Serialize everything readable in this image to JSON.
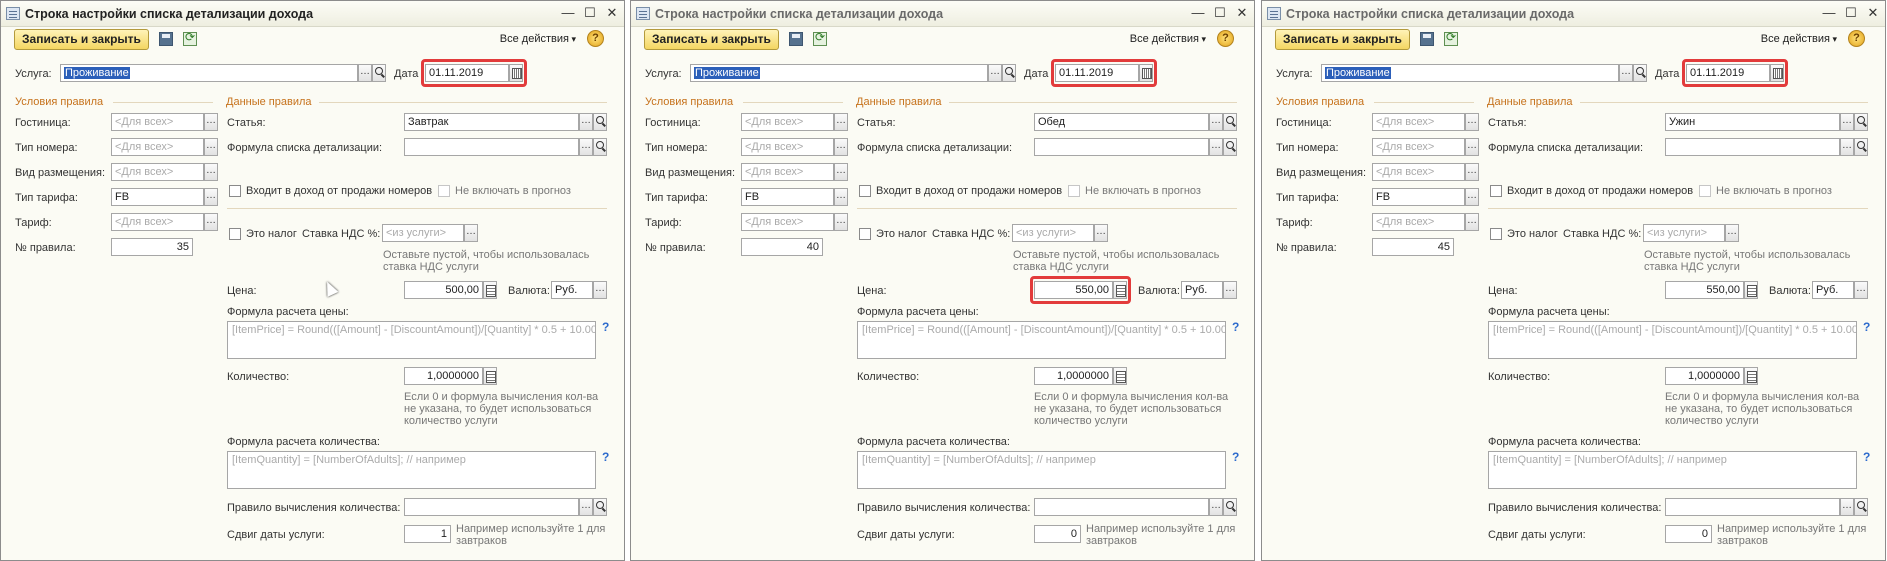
{
  "windows": [
    {
      "title": "Строка настройки списка детализации дохода",
      "active": true,
      "save_label": "Записать и закрыть",
      "all_actions": "Все действия",
      "help": "?",
      "service_label": "Услуга:",
      "service_value": "Проживание",
      "date_label": "Дата",
      "date_value": "01.11.2019",
      "conditions_header": "Условия правила",
      "data_header": "Данные правила",
      "hotel_label": "Гостиница:",
      "hotel_value": "<Для всех>",
      "room_type_label": "Тип номера:",
      "room_type_value": "<Для всех>",
      "accommodation_label": "Вид размещения:",
      "accommodation_value": "<Для всех>",
      "rate_type_label": "Тип тарифа:",
      "rate_type_value": "FB",
      "rate_label": "Тариф:",
      "rate_value": "<Для всех>",
      "rule_no_label": "№ правила:",
      "rule_no_value": "35",
      "article_label": "Статья:",
      "article_value": "Завтрак",
      "formula_list_label": "Формула списка детализации:",
      "income_checkbox_label": "Входит в доход от продажи номеров",
      "forecast_checkbox_label": "Не включать в прогноз",
      "tax_checkbox_label": "Это налог",
      "vat_label": "Ставка НДС %:",
      "vat_value": "<из услуги>",
      "vat_hint_1": "Оставьте пустой, чтобы использовалась",
      "vat_hint_2": "ставка НДС услуги",
      "price_label": "Цена:",
      "price_value": "500,00",
      "currency_label": "Валюта:",
      "currency_value": "Руб.",
      "price_formula_label": "Формула расчета цены:",
      "price_formula_placeholder": "[ItemPrice] = Round(([Amount] - [DiscountAmount])/[Quantity] * 0.5 + 10.00...",
      "qty_label": "Количество:",
      "qty_value": "1,0000000",
      "qty_hint_1": "Если 0 и формула вычисления кол-ва",
      "qty_hint_2": "не указана, то будет использоваться",
      "qty_hint_3": "количество услуги",
      "qty_formula_label": "Формула расчета количества:",
      "qty_formula_placeholder": "[ItemQuantity] = [NumberOfAdults]; // например",
      "qty_rule_label": "Правило вычисления количества:",
      "date_shift_label": "Сдвиг даты услуги:",
      "date_shift_value": "1",
      "date_shift_hint_1": "Например используйте 1 для",
      "date_shift_hint_2": "завтраков"
    },
    {
      "title": "Строка настройки списка детализации дохода",
      "active": false,
      "save_label": "Записать и закрыть",
      "all_actions": "Все действия",
      "help": "?",
      "service_label": "Услуга:",
      "service_value": "Проживание",
      "date_label": "Дата",
      "date_value": "01.11.2019",
      "conditions_header": "Условия правила",
      "data_header": "Данные правила",
      "hotel_label": "Гостиница:",
      "hotel_value": "<Для всех>",
      "room_type_label": "Тип номера:",
      "room_type_value": "<Для всех>",
      "accommodation_label": "Вид размещения:",
      "accommodation_value": "<Для всех>",
      "rate_type_label": "Тип тарифа:",
      "rate_type_value": "FB",
      "rate_label": "Тариф:",
      "rate_value": "<Для всех>",
      "rule_no_label": "№ правила:",
      "rule_no_value": "40",
      "article_label": "Статья:",
      "article_value": "Обед",
      "formula_list_label": "Формула списка детализации:",
      "income_checkbox_label": "Входит в доход от продажи номеров",
      "forecast_checkbox_label": "Не включать в прогноз",
      "tax_checkbox_label": "Это налог",
      "vat_label": "Ставка НДС %:",
      "vat_value": "<из услуги>",
      "vat_hint_1": "Оставьте пустой, чтобы использовалась",
      "vat_hint_2": "ставка НДС услуги",
      "price_label": "Цена:",
      "price_value": "550,00",
      "currency_label": "Валюта:",
      "currency_value": "Руб.",
      "price_formula_label": "Формула расчета цены:",
      "price_formula_placeholder": "[ItemPrice] = Round(([Amount] - [DiscountAmount])/[Quantity] * 0.5 + 10.00...",
      "qty_label": "Количество:",
      "qty_value": "1,0000000",
      "qty_hint_1": "Если 0 и формула вычисления кол-ва",
      "qty_hint_2": "не указана, то будет использоваться",
      "qty_hint_3": "количество услуги",
      "qty_formula_label": "Формула расчета количества:",
      "qty_formula_placeholder": "[ItemQuantity] = [NumberOfAdults]; // например",
      "qty_rule_label": "Правило вычисления количества:",
      "date_shift_label": "Сдвиг даты услуги:",
      "date_shift_value": "0",
      "date_shift_hint_1": "Например используйте 1 для",
      "date_shift_hint_2": "завтраков"
    },
    {
      "title": "Строка настройки списка детализации дохода",
      "active": false,
      "save_label": "Записать и закрыть",
      "all_actions": "Все действия",
      "help": "?",
      "service_label": "Услуга:",
      "service_value": "Проживание",
      "date_label": "Дата",
      "date_value": "01.11.2019",
      "conditions_header": "Условия правила",
      "data_header": "Данные правила",
      "hotel_label": "Гостиница:",
      "hotel_value": "<Для всех>",
      "room_type_label": "Тип номера:",
      "room_type_value": "<Для всех>",
      "accommodation_label": "Вид размещения:",
      "accommodation_value": "<Для всех>",
      "rate_type_label": "Тип тарифа:",
      "rate_type_value": "FB",
      "rate_label": "Тариф:",
      "rate_value": "<Для всех>",
      "rule_no_label": "№ правила:",
      "rule_no_value": "45",
      "article_label": "Статья:",
      "article_value": "Ужин",
      "formula_list_label": "Формула списка детализации:",
      "income_checkbox_label": "Входит в доход от продажи номеров",
      "forecast_checkbox_label": "Не включать в прогноз",
      "tax_checkbox_label": "Это налог",
      "vat_label": "Ставка НДС %:",
      "vat_value": "<из услуги>",
      "vat_hint_1": "Оставьте пустой, чтобы использовалась",
      "vat_hint_2": "ставка НДС услуги",
      "price_label": "Цена:",
      "price_value": "550,00",
      "currency_label": "Валюта:",
      "currency_value": "Руб.",
      "price_formula_label": "Формула расчета цены:",
      "price_formula_placeholder": "[ItemPrice] = Round(([Amount] - [DiscountAmount])/[Quantity] * 0.5 + 10.00...",
      "qty_label": "Количество:",
      "qty_value": "1,0000000",
      "qty_hint_1": "Если 0 и формула вычисления кол-ва",
      "qty_hint_2": "не указана, то будет использоваться",
      "qty_hint_3": "количество услуги",
      "qty_formula_label": "Формула расчета количества:",
      "qty_formula_placeholder": "[ItemQuantity] = [NumberOfAdults]; // например",
      "qty_rule_label": "Правило вычисления количества:",
      "date_shift_label": "Сдвиг даты услуги:",
      "date_shift_value": "0",
      "date_shift_hint_1": "Например используйте 1 для",
      "date_shift_hint_2": "завтраков"
    }
  ],
  "colors": {
    "section_header": "#c6721c",
    "highlight_frame": "#e23b3b",
    "save_button": "#f4d662",
    "selection": "#2c5fb9"
  },
  "icons": [
    "window-icon",
    "minimize-icon",
    "maximize-icon",
    "close-icon",
    "save-icon",
    "refresh-icon",
    "help-icon",
    "select-button-icon",
    "search-icon",
    "calendar-icon",
    "calculator-icon",
    "question-icon",
    "mouse-cursor"
  ]
}
